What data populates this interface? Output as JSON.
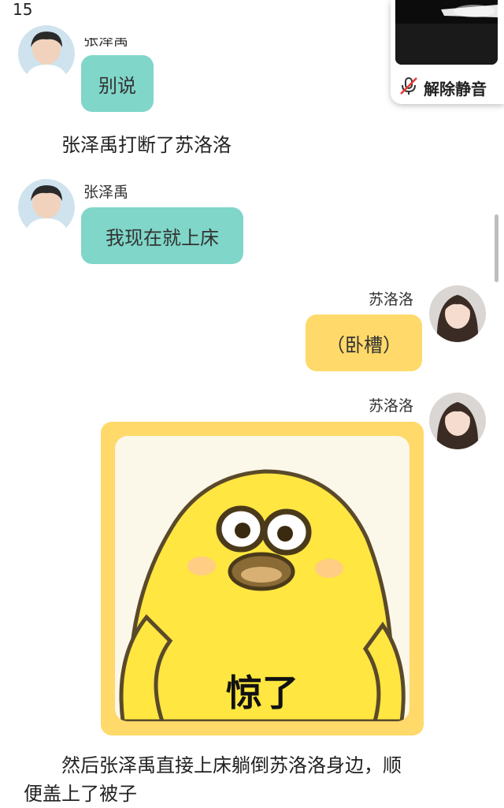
{
  "status_bar": {
    "time": "15"
  },
  "messages": [
    {
      "sender": "张泽禹",
      "text": "别说"
    },
    {
      "narration": "张泽禹打断了苏洛洛"
    },
    {
      "sender": "张泽禹",
      "text": "我现在就上床"
    },
    {
      "sender": "苏洛洛",
      "text": "（卧槽）"
    },
    {
      "sender": "苏洛洛",
      "sticker_caption": "惊了"
    },
    {
      "narration_line1": "然后张泽禹直接上床躺倒苏洛洛身边，顺",
      "narration_line2": "便盖上了被子"
    }
  ],
  "call_widget": {
    "unmute_label": "解除静音",
    "icon": "mic-muted-icon"
  },
  "colors": {
    "green_bubble": "#7fd6c9",
    "yellow_bubble": "#ffd96a"
  }
}
